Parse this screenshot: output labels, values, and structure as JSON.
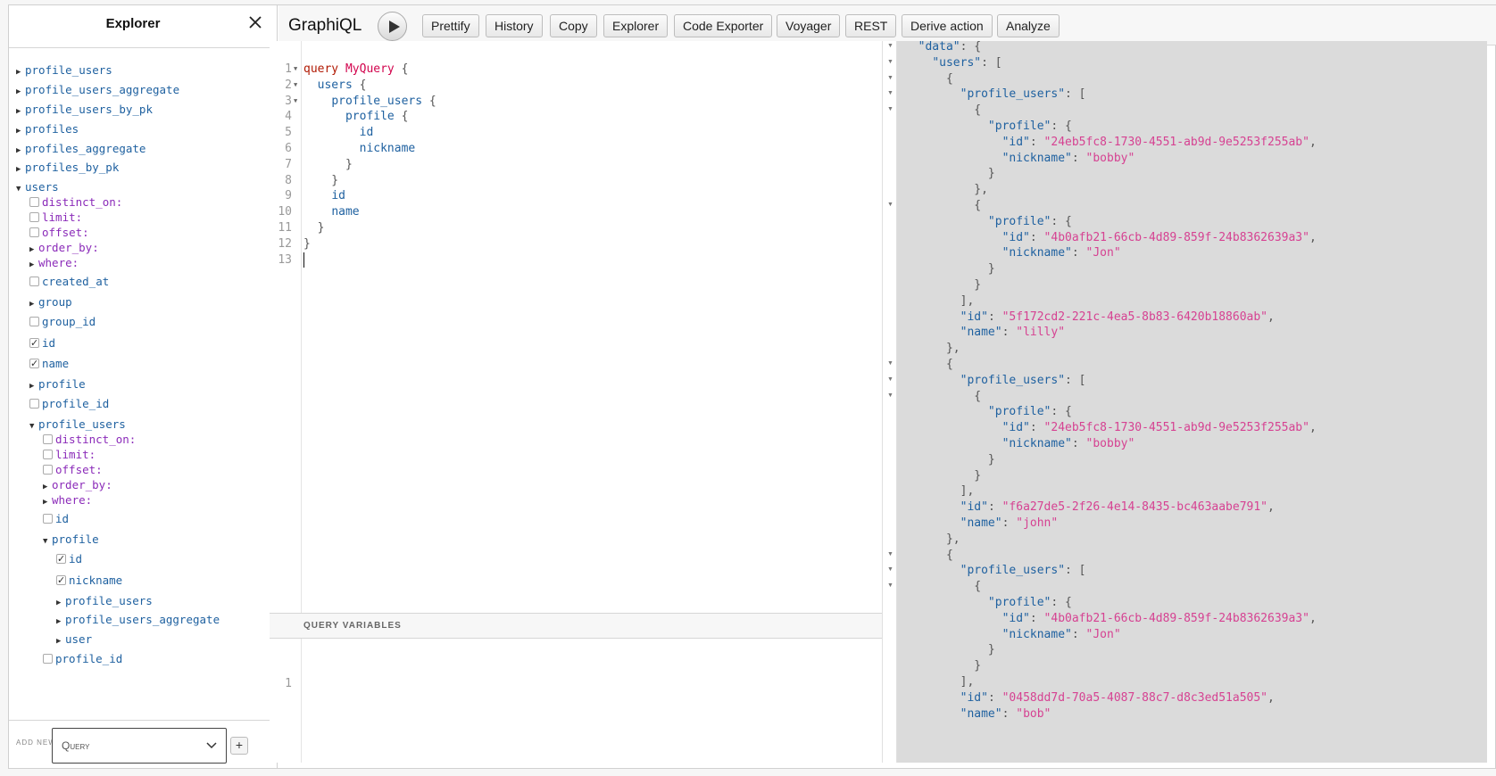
{
  "explorer": {
    "title": "Explorer",
    "tree": [
      {
        "label": "profile_users",
        "kind": "field",
        "control": "caret-right",
        "depth": 0
      },
      {
        "label": "profile_users_aggregate",
        "kind": "field",
        "control": "caret-right",
        "depth": 0
      },
      {
        "label": "profile_users_by_pk",
        "kind": "field",
        "control": "caret-right",
        "depth": 0
      },
      {
        "label": "profiles",
        "kind": "field",
        "control": "caret-right",
        "depth": 0
      },
      {
        "label": "profiles_aggregate",
        "kind": "field",
        "control": "caret-right",
        "depth": 0
      },
      {
        "label": "profiles_by_pk",
        "kind": "field",
        "control": "caret-right",
        "depth": 0
      },
      {
        "label": "users",
        "kind": "field",
        "control": "caret-down",
        "depth": 0
      },
      {
        "label": "distinct_on:",
        "kind": "arg",
        "control": "checkbox",
        "checked": false,
        "depth": 1
      },
      {
        "label": "limit:",
        "kind": "arg",
        "control": "checkbox",
        "checked": false,
        "depth": 1
      },
      {
        "label": "offset:",
        "kind": "arg",
        "control": "checkbox",
        "checked": false,
        "depth": 1
      },
      {
        "label": "order_by:",
        "kind": "arg",
        "control": "caret-right",
        "depth": 1
      },
      {
        "label": "where:",
        "kind": "arg",
        "control": "caret-right",
        "depth": 1
      },
      {
        "label": "created_at",
        "kind": "field",
        "control": "checkbox",
        "checked": false,
        "depth": 1
      },
      {
        "label": "group",
        "kind": "field",
        "control": "caret-right",
        "depth": 1
      },
      {
        "label": "group_id",
        "kind": "field",
        "control": "checkbox",
        "checked": false,
        "depth": 1
      },
      {
        "label": "id",
        "kind": "field",
        "control": "checkbox",
        "checked": true,
        "depth": 1
      },
      {
        "label": "name",
        "kind": "field",
        "control": "checkbox",
        "checked": true,
        "depth": 1
      },
      {
        "label": "profile",
        "kind": "field",
        "control": "caret-right",
        "depth": 1
      },
      {
        "label": "profile_id",
        "kind": "field",
        "control": "checkbox",
        "checked": false,
        "depth": 1
      },
      {
        "label": "profile_users",
        "kind": "field",
        "control": "caret-down",
        "depth": 1
      },
      {
        "label": "distinct_on:",
        "kind": "arg",
        "control": "checkbox",
        "checked": false,
        "depth": 2
      },
      {
        "label": "limit:",
        "kind": "arg",
        "control": "checkbox",
        "checked": false,
        "depth": 2
      },
      {
        "label": "offset:",
        "kind": "arg",
        "control": "checkbox",
        "checked": false,
        "depth": 2
      },
      {
        "label": "order_by:",
        "kind": "arg",
        "control": "caret-right",
        "depth": 2
      },
      {
        "label": "where:",
        "kind": "arg",
        "control": "caret-right",
        "depth": 2
      },
      {
        "label": "id",
        "kind": "field",
        "control": "checkbox",
        "checked": false,
        "depth": 2
      },
      {
        "label": "profile",
        "kind": "field",
        "control": "caret-down",
        "depth": 2
      },
      {
        "label": "id",
        "kind": "field",
        "control": "checkbox",
        "checked": true,
        "depth": 3
      },
      {
        "label": "nickname",
        "kind": "field",
        "control": "checkbox",
        "checked": true,
        "depth": 3
      },
      {
        "label": "profile_users",
        "kind": "field",
        "control": "caret-right",
        "depth": 3
      },
      {
        "label": "profile_users_aggregate",
        "kind": "field",
        "control": "caret-right",
        "depth": 3
      },
      {
        "label": "user",
        "kind": "field",
        "control": "caret-right",
        "depth": 3
      },
      {
        "label": "profile_id",
        "kind": "field",
        "control": "checkbox",
        "checked": false,
        "depth": 2
      }
    ],
    "footer": {
      "add_new_label": "ADD NEW",
      "operation_type": "Query",
      "plus_label": "+"
    }
  },
  "toolbar": {
    "brand": "GraphiQL",
    "buttons": [
      "Prettify",
      "History",
      "Copy",
      "Explorer",
      "Code Exporter",
      "Voyager",
      "REST",
      "Derive action",
      "Analyze"
    ]
  },
  "editor": {
    "lines": [
      {
        "n": "1",
        "fold": true,
        "parts": [
          [
            "kw",
            "query "
          ],
          [
            "def",
            "MyQuery"
          ],
          [
            "punc",
            " {"
          ]
        ]
      },
      {
        "n": "2",
        "fold": true,
        "parts": [
          [
            "punc",
            "  "
          ],
          [
            "f",
            "users"
          ],
          [
            "punc",
            " {"
          ]
        ]
      },
      {
        "n": "3",
        "fold": true,
        "parts": [
          [
            "punc",
            "    "
          ],
          [
            "f",
            "profile_users"
          ],
          [
            "punc",
            " {"
          ]
        ]
      },
      {
        "n": "4",
        "fold": false,
        "parts": [
          [
            "punc",
            "      "
          ],
          [
            "f",
            "profile"
          ],
          [
            "punc",
            " {"
          ]
        ]
      },
      {
        "n": "5",
        "fold": false,
        "parts": [
          [
            "punc",
            "        "
          ],
          [
            "f",
            "id"
          ]
        ]
      },
      {
        "n": "6",
        "fold": false,
        "parts": [
          [
            "punc",
            "        "
          ],
          [
            "f",
            "nickname"
          ]
        ]
      },
      {
        "n": "7",
        "fold": false,
        "parts": [
          [
            "punc",
            "      }"
          ]
        ]
      },
      {
        "n": "8",
        "fold": false,
        "parts": [
          [
            "punc",
            "    }"
          ]
        ]
      },
      {
        "n": "9",
        "fold": false,
        "parts": [
          [
            "punc",
            "    "
          ],
          [
            "f",
            "id"
          ]
        ]
      },
      {
        "n": "10",
        "fold": false,
        "parts": [
          [
            "punc",
            "    "
          ],
          [
            "f",
            "name"
          ]
        ]
      },
      {
        "n": "11",
        "fold": false,
        "parts": [
          [
            "punc",
            "  }"
          ]
        ]
      },
      {
        "n": "12",
        "fold": false,
        "parts": [
          [
            "punc",
            "}"
          ]
        ]
      },
      {
        "n": "13",
        "fold": false,
        "parts": []
      }
    ]
  },
  "variables": {
    "header": "QUERY VARIABLES",
    "line_numbers": [
      "1"
    ]
  },
  "result": {
    "lines": [
      [
        [
          "punc",
          "  "
        ],
        [
          "rk",
          "\"data\""
        ],
        [
          "punc",
          ": {"
        ]
      ],
      [
        [
          "punc",
          "    "
        ],
        [
          "rk",
          "\"users\""
        ],
        [
          "punc",
          ": ["
        ]
      ],
      [
        [
          "punc",
          "      {"
        ]
      ],
      [
        [
          "punc",
          "        "
        ],
        [
          "rk",
          "\"profile_users\""
        ],
        [
          "punc",
          ": ["
        ]
      ],
      [
        [
          "punc",
          "          {"
        ]
      ],
      [
        [
          "punc",
          "            "
        ],
        [
          "rk",
          "\"profile\""
        ],
        [
          "punc",
          ": {"
        ]
      ],
      [
        [
          "punc",
          "              "
        ],
        [
          "rk",
          "\"id\""
        ],
        [
          "punc",
          ": "
        ],
        [
          "rs",
          "\"24eb5fc8-1730-4551-ab9d-9e5253f255ab\""
        ],
        [
          "punc",
          ","
        ]
      ],
      [
        [
          "punc",
          "              "
        ],
        [
          "rk",
          "\"nickname\""
        ],
        [
          "punc",
          ": "
        ],
        [
          "rs",
          "\"bobby\""
        ]
      ],
      [
        [
          "punc",
          "            }"
        ]
      ],
      [
        [
          "punc",
          "          },"
        ]
      ],
      [
        [
          "punc",
          "          {"
        ]
      ],
      [
        [
          "punc",
          "            "
        ],
        [
          "rk",
          "\"profile\""
        ],
        [
          "punc",
          ": {"
        ]
      ],
      [
        [
          "punc",
          "              "
        ],
        [
          "rk",
          "\"id\""
        ],
        [
          "punc",
          ": "
        ],
        [
          "rs",
          "\"4b0afb21-66cb-4d89-859f-24b8362639a3\""
        ],
        [
          "punc",
          ","
        ]
      ],
      [
        [
          "punc",
          "              "
        ],
        [
          "rk",
          "\"nickname\""
        ],
        [
          "punc",
          ": "
        ],
        [
          "rs",
          "\"Jon\""
        ]
      ],
      [
        [
          "punc",
          "            }"
        ]
      ],
      [
        [
          "punc",
          "          }"
        ]
      ],
      [
        [
          "punc",
          "        ],"
        ]
      ],
      [
        [
          "punc",
          "        "
        ],
        [
          "rk",
          "\"id\""
        ],
        [
          "punc",
          ": "
        ],
        [
          "rs",
          "\"5f172cd2-221c-4ea5-8b83-6420b18860ab\""
        ],
        [
          "punc",
          ","
        ]
      ],
      [
        [
          "punc",
          "        "
        ],
        [
          "rk",
          "\"name\""
        ],
        [
          "punc",
          ": "
        ],
        [
          "rs",
          "\"lilly\""
        ]
      ],
      [
        [
          "punc",
          "      },"
        ]
      ],
      [
        [
          "punc",
          "      {"
        ]
      ],
      [
        [
          "punc",
          "        "
        ],
        [
          "rk",
          "\"profile_users\""
        ],
        [
          "punc",
          ": ["
        ]
      ],
      [
        [
          "punc",
          "          {"
        ]
      ],
      [
        [
          "punc",
          "            "
        ],
        [
          "rk",
          "\"profile\""
        ],
        [
          "punc",
          ": {"
        ]
      ],
      [
        [
          "punc",
          "              "
        ],
        [
          "rk",
          "\"id\""
        ],
        [
          "punc",
          ": "
        ],
        [
          "rs",
          "\"24eb5fc8-1730-4551-ab9d-9e5253f255ab\""
        ],
        [
          "punc",
          ","
        ]
      ],
      [
        [
          "punc",
          "              "
        ],
        [
          "rk",
          "\"nickname\""
        ],
        [
          "punc",
          ": "
        ],
        [
          "rs",
          "\"bobby\""
        ]
      ],
      [
        [
          "punc",
          "            }"
        ]
      ],
      [
        [
          "punc",
          "          }"
        ]
      ],
      [
        [
          "punc",
          "        ],"
        ]
      ],
      [
        [
          "punc",
          "        "
        ],
        [
          "rk",
          "\"id\""
        ],
        [
          "punc",
          ": "
        ],
        [
          "rs",
          "\"f6a27de5-2f26-4e14-8435-bc463aabe791\""
        ],
        [
          "punc",
          ","
        ]
      ],
      [
        [
          "punc",
          "        "
        ],
        [
          "rk",
          "\"name\""
        ],
        [
          "punc",
          ": "
        ],
        [
          "rs",
          "\"john\""
        ]
      ],
      [
        [
          "punc",
          "      },"
        ]
      ],
      [
        [
          "punc",
          "      {"
        ]
      ],
      [
        [
          "punc",
          "        "
        ],
        [
          "rk",
          "\"profile_users\""
        ],
        [
          "punc",
          ": ["
        ]
      ],
      [
        [
          "punc",
          "          {"
        ]
      ],
      [
        [
          "punc",
          "            "
        ],
        [
          "rk",
          "\"profile\""
        ],
        [
          "punc",
          ": {"
        ]
      ],
      [
        [
          "punc",
          "              "
        ],
        [
          "rk",
          "\"id\""
        ],
        [
          "punc",
          ": "
        ],
        [
          "rs",
          "\"4b0afb21-66cb-4d89-859f-24b8362639a3\""
        ],
        [
          "punc",
          ","
        ]
      ],
      [
        [
          "punc",
          "              "
        ],
        [
          "rk",
          "\"nickname\""
        ],
        [
          "punc",
          ": "
        ],
        [
          "rs",
          "\"Jon\""
        ]
      ],
      [
        [
          "punc",
          "            }"
        ]
      ],
      [
        [
          "punc",
          "          }"
        ]
      ],
      [
        [
          "punc",
          "        ],"
        ]
      ],
      [
        [
          "punc",
          "        "
        ],
        [
          "rk",
          "\"id\""
        ],
        [
          "punc",
          ": "
        ],
        [
          "rs",
          "\"0458dd7d-70a5-4087-88c7-d8c3ed51a505\""
        ],
        [
          "punc",
          ","
        ]
      ],
      [
        [
          "punc",
          "        "
        ],
        [
          "rk",
          "\"name\""
        ],
        [
          "punc",
          ": "
        ],
        [
          "rs",
          "\"bob\""
        ]
      ]
    ],
    "fold_markers_at_lines": [
      0,
      1,
      2,
      3,
      4,
      10,
      20,
      21,
      22,
      32,
      33,
      34
    ]
  }
}
